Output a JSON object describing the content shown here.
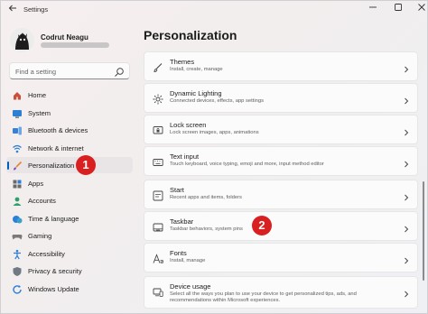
{
  "app": {
    "title": "Settings"
  },
  "user": {
    "name": "Codrut Neagu"
  },
  "search": {
    "placeholder": "Find a setting"
  },
  "nav": {
    "items": [
      {
        "label": "Home",
        "icon": "home-icon"
      },
      {
        "label": "System",
        "icon": "system-icon"
      },
      {
        "label": "Bluetooth & devices",
        "icon": "bluetooth-icon"
      },
      {
        "label": "Network & internet",
        "icon": "network-icon"
      },
      {
        "label": "Personalization",
        "icon": "brush-icon",
        "selected": true
      },
      {
        "label": "Apps",
        "icon": "apps-icon"
      },
      {
        "label": "Accounts",
        "icon": "accounts-icon"
      },
      {
        "label": "Time & language",
        "icon": "time-language-icon"
      },
      {
        "label": "Gaming",
        "icon": "gaming-icon"
      },
      {
        "label": "Accessibility",
        "icon": "accessibility-icon"
      },
      {
        "label": "Privacy & security",
        "icon": "shield-icon"
      },
      {
        "label": "Windows Update",
        "icon": "windows-update-icon"
      }
    ]
  },
  "main": {
    "title": "Personalization",
    "cards": [
      {
        "title": "Themes",
        "subtitle": "Install, create, manage",
        "icon": "themes-icon"
      },
      {
        "title": "Dynamic Lighting",
        "subtitle": "Connected devices, effects, app settings",
        "icon": "dynamic-lighting-icon"
      },
      {
        "title": "Lock screen",
        "subtitle": "Lock screen images, apps, animations",
        "icon": "lock-screen-icon"
      },
      {
        "title": "Text input",
        "subtitle": "Touch keyboard, voice typing, emoji and more, input method editor",
        "icon": "keyboard-icon"
      },
      {
        "title": "Start",
        "subtitle": "Recent apps and items, folders",
        "icon": "start-icon"
      },
      {
        "title": "Taskbar",
        "subtitle": "Taskbar behaviors, system pins",
        "icon": "taskbar-icon"
      },
      {
        "title": "Fonts",
        "subtitle": "Install, manage",
        "icon": "fonts-icon"
      },
      {
        "title": "Device usage",
        "subtitle": "Select all the ways you plan to use your device to get personalized tips, ads, and recommendations within Microsoft experiences.",
        "icon": "device-usage-icon"
      }
    ]
  },
  "callouts": {
    "one": "1",
    "two": "2"
  },
  "colors": {
    "accent": "#005fb8",
    "callout": "#d91f1f"
  }
}
